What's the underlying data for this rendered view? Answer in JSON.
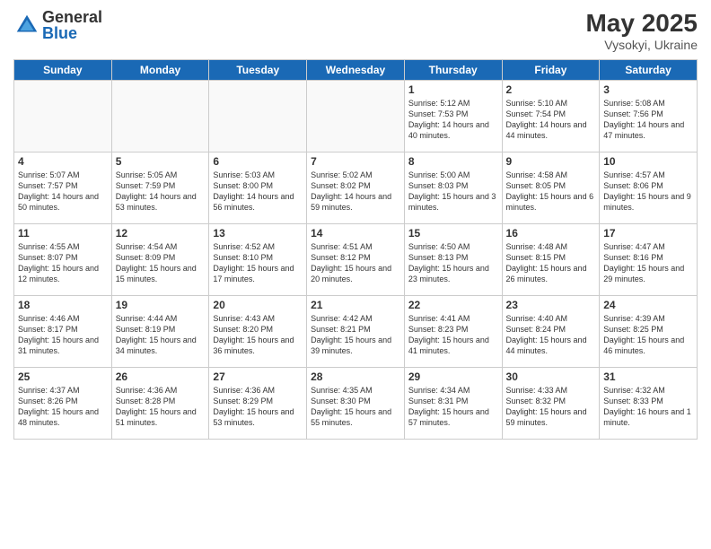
{
  "logo": {
    "general": "General",
    "blue": "Blue"
  },
  "title": {
    "month_year": "May 2025",
    "location": "Vysokyi, Ukraine"
  },
  "weekdays": [
    "Sunday",
    "Monday",
    "Tuesday",
    "Wednesday",
    "Thursday",
    "Friday",
    "Saturday"
  ],
  "rows": [
    [
      {
        "day": "",
        "empty": true
      },
      {
        "day": "",
        "empty": true
      },
      {
        "day": "",
        "empty": true
      },
      {
        "day": "",
        "empty": true
      },
      {
        "day": "1",
        "sunrise": "5:12 AM",
        "sunset": "7:53 PM",
        "daylight": "14 hours and 40 minutes."
      },
      {
        "day": "2",
        "sunrise": "5:10 AM",
        "sunset": "7:54 PM",
        "daylight": "14 hours and 44 minutes."
      },
      {
        "day": "3",
        "sunrise": "5:08 AM",
        "sunset": "7:56 PM",
        "daylight": "14 hours and 47 minutes."
      }
    ],
    [
      {
        "day": "4",
        "sunrise": "5:07 AM",
        "sunset": "7:57 PM",
        "daylight": "14 hours and 50 minutes."
      },
      {
        "day": "5",
        "sunrise": "5:05 AM",
        "sunset": "7:59 PM",
        "daylight": "14 hours and 53 minutes."
      },
      {
        "day": "6",
        "sunrise": "5:03 AM",
        "sunset": "8:00 PM",
        "daylight": "14 hours and 56 minutes."
      },
      {
        "day": "7",
        "sunrise": "5:02 AM",
        "sunset": "8:02 PM",
        "daylight": "14 hours and 59 minutes."
      },
      {
        "day": "8",
        "sunrise": "5:00 AM",
        "sunset": "8:03 PM",
        "daylight": "15 hours and 3 minutes."
      },
      {
        "day": "9",
        "sunrise": "4:58 AM",
        "sunset": "8:05 PM",
        "daylight": "15 hours and 6 minutes."
      },
      {
        "day": "10",
        "sunrise": "4:57 AM",
        "sunset": "8:06 PM",
        "daylight": "15 hours and 9 minutes."
      }
    ],
    [
      {
        "day": "11",
        "sunrise": "4:55 AM",
        "sunset": "8:07 PM",
        "daylight": "15 hours and 12 minutes."
      },
      {
        "day": "12",
        "sunrise": "4:54 AM",
        "sunset": "8:09 PM",
        "daylight": "15 hours and 15 minutes."
      },
      {
        "day": "13",
        "sunrise": "4:52 AM",
        "sunset": "8:10 PM",
        "daylight": "15 hours and 17 minutes."
      },
      {
        "day": "14",
        "sunrise": "4:51 AM",
        "sunset": "8:12 PM",
        "daylight": "15 hours and 20 minutes."
      },
      {
        "day": "15",
        "sunrise": "4:50 AM",
        "sunset": "8:13 PM",
        "daylight": "15 hours and 23 minutes."
      },
      {
        "day": "16",
        "sunrise": "4:48 AM",
        "sunset": "8:15 PM",
        "daylight": "15 hours and 26 minutes."
      },
      {
        "day": "17",
        "sunrise": "4:47 AM",
        "sunset": "8:16 PM",
        "daylight": "15 hours and 29 minutes."
      }
    ],
    [
      {
        "day": "18",
        "sunrise": "4:46 AM",
        "sunset": "8:17 PM",
        "daylight": "15 hours and 31 minutes."
      },
      {
        "day": "19",
        "sunrise": "4:44 AM",
        "sunset": "8:19 PM",
        "daylight": "15 hours and 34 minutes."
      },
      {
        "day": "20",
        "sunrise": "4:43 AM",
        "sunset": "8:20 PM",
        "daylight": "15 hours and 36 minutes."
      },
      {
        "day": "21",
        "sunrise": "4:42 AM",
        "sunset": "8:21 PM",
        "daylight": "15 hours and 39 minutes."
      },
      {
        "day": "22",
        "sunrise": "4:41 AM",
        "sunset": "8:23 PM",
        "daylight": "15 hours and 41 minutes."
      },
      {
        "day": "23",
        "sunrise": "4:40 AM",
        "sunset": "8:24 PM",
        "daylight": "15 hours and 44 minutes."
      },
      {
        "day": "24",
        "sunrise": "4:39 AM",
        "sunset": "8:25 PM",
        "daylight": "15 hours and 46 minutes."
      }
    ],
    [
      {
        "day": "25",
        "sunrise": "4:37 AM",
        "sunset": "8:26 PM",
        "daylight": "15 hours and 48 minutes."
      },
      {
        "day": "26",
        "sunrise": "4:36 AM",
        "sunset": "8:28 PM",
        "daylight": "15 hours and 51 minutes."
      },
      {
        "day": "27",
        "sunrise": "4:36 AM",
        "sunset": "8:29 PM",
        "daylight": "15 hours and 53 minutes."
      },
      {
        "day": "28",
        "sunrise": "4:35 AM",
        "sunset": "8:30 PM",
        "daylight": "15 hours and 55 minutes."
      },
      {
        "day": "29",
        "sunrise": "4:34 AM",
        "sunset": "8:31 PM",
        "daylight": "15 hours and 57 minutes."
      },
      {
        "day": "30",
        "sunrise": "4:33 AM",
        "sunset": "8:32 PM",
        "daylight": "15 hours and 59 minutes."
      },
      {
        "day": "31",
        "sunrise": "4:32 AM",
        "sunset": "8:33 PM",
        "daylight": "16 hours and 1 minute."
      }
    ]
  ]
}
